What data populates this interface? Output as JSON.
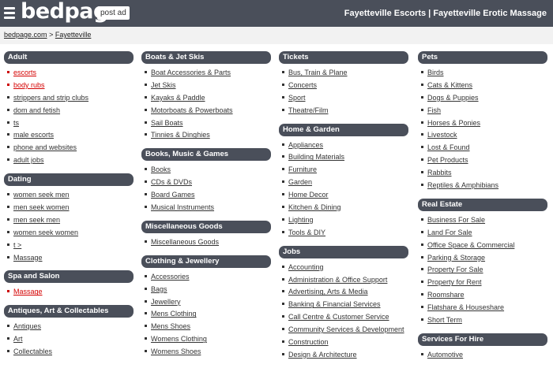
{
  "header": {
    "logo": "bedpage",
    "post_ad": "post ad",
    "title": "Fayetteville Escorts | Fayetteville Erotic Massage"
  },
  "breadcrumb": {
    "home": "bedpage.com",
    "sep": ">",
    "city": "Fayetteville"
  },
  "colors": {
    "header_bg": "#4a4f5a",
    "link_red": "#d40000"
  },
  "columns": [
    {
      "categories": [
        {
          "title": "Adult",
          "items": [
            {
              "label": "escorts",
              "red": true
            },
            {
              "label": "body rubs",
              "red": true
            },
            {
              "label": "strippers and strip clubs",
              "red": false
            },
            {
              "label": "dom and fetish",
              "red": false
            },
            {
              "label": "ts",
              "red": false
            },
            {
              "label": "male escorts",
              "red": false
            },
            {
              "label": "phone and websites",
              "red": false
            },
            {
              "label": "adult jobs",
              "red": false
            }
          ]
        },
        {
          "title": "Dating",
          "items": [
            {
              "label": "women seek men",
              "red": false
            },
            {
              "label": "men seek women",
              "red": false
            },
            {
              "label": "men seek men",
              "red": false
            },
            {
              "label": "women seek women",
              "red": false
            },
            {
              "label": "t >",
              "red": false
            },
            {
              "label": "Massage",
              "red": false
            }
          ]
        },
        {
          "title": "Spa and Salon",
          "items": [
            {
              "label": "Massage",
              "red": true
            }
          ]
        },
        {
          "title": "Antiques, Art & Collectables",
          "items": [
            {
              "label": "Antiques",
              "red": false
            },
            {
              "label": "Art",
              "red": false
            },
            {
              "label": "Collectables",
              "red": false
            }
          ]
        }
      ]
    },
    {
      "categories": [
        {
          "title": "Boats & Jet Skis",
          "items": [
            {
              "label": "Boat Accessories & Parts",
              "red": false
            },
            {
              "label": "Jet Skis",
              "red": false
            },
            {
              "label": "Kayaks & Paddle",
              "red": false
            },
            {
              "label": "Motorboats & Powerboats",
              "red": false
            },
            {
              "label": "Sail Boats",
              "red": false
            },
            {
              "label": "Tinnies & Dinghies",
              "red": false
            }
          ]
        },
        {
          "title": "Books, Music & Games",
          "items": [
            {
              "label": "Books",
              "red": false
            },
            {
              "label": "CDs & DVDs",
              "red": false
            },
            {
              "label": "Board Games",
              "red": false
            },
            {
              "label": "Musical Instruments",
              "red": false
            }
          ]
        },
        {
          "title": "Miscellaneous Goods",
          "items": [
            {
              "label": "Miscellaneous Goods",
              "red": false
            }
          ]
        },
        {
          "title": "Clothing & Jewellery",
          "items": [
            {
              "label": "Accessories",
              "red": false
            },
            {
              "label": "Bags",
              "red": false
            },
            {
              "label": "Jewellery",
              "red": false
            },
            {
              "label": "Mens Clothing",
              "red": false
            },
            {
              "label": "Mens Shoes",
              "red": false
            },
            {
              "label": "Womens Clothing",
              "red": false
            },
            {
              "label": "Womens Shoes",
              "red": false
            }
          ]
        }
      ]
    },
    {
      "categories": [
        {
          "title": "Tickets",
          "items": [
            {
              "label": "Bus, Train & Plane",
              "red": false
            },
            {
              "label": "Concerts",
              "red": false
            },
            {
              "label": "Sport",
              "red": false
            },
            {
              "label": "Theatre/Film",
              "red": false
            }
          ]
        },
        {
          "title": "Home & Garden",
          "items": [
            {
              "label": "Appliances",
              "red": false
            },
            {
              "label": "Building Materials",
              "red": false
            },
            {
              "label": "Furniture",
              "red": false
            },
            {
              "label": "Garden",
              "red": false
            },
            {
              "label": "Home Decor",
              "red": false
            },
            {
              "label": "Kitchen & Dining",
              "red": false
            },
            {
              "label": "Lighting",
              "red": false
            },
            {
              "label": "Tools & DIY",
              "red": false
            }
          ]
        },
        {
          "title": "Jobs",
          "items": [
            {
              "label": "Accounting",
              "red": false
            },
            {
              "label": "Administration & Office Support",
              "red": false
            },
            {
              "label": "Advertising, Arts & Media",
              "red": false
            },
            {
              "label": "Banking & Financial Services",
              "red": false
            },
            {
              "label": "Call Centre & Customer Service",
              "red": false
            },
            {
              "label": "Community Services & Development",
              "red": false
            },
            {
              "label": "Construction",
              "red": false
            },
            {
              "label": "Design & Architecture",
              "red": false
            }
          ]
        }
      ]
    },
    {
      "categories": [
        {
          "title": "Pets",
          "items": [
            {
              "label": "Birds",
              "red": false
            },
            {
              "label": "Cats & Kittens",
              "red": false
            },
            {
              "label": "Dogs & Puppies",
              "red": false
            },
            {
              "label": "Fish",
              "red": false
            },
            {
              "label": "Horses & Ponies",
              "red": false
            },
            {
              "label": "Livestock",
              "red": false
            },
            {
              "label": "Lost & Found",
              "red": false
            },
            {
              "label": "Pet Products",
              "red": false
            },
            {
              "label": "Rabbits",
              "red": false
            },
            {
              "label": "Reptiles & Amphibians",
              "red": false
            }
          ]
        },
        {
          "title": "Real Estate",
          "items": [
            {
              "label": "Business For Sale",
              "red": false
            },
            {
              "label": "Land For Sale",
              "red": false
            },
            {
              "label": "Office Space & Commercial",
              "red": false
            },
            {
              "label": "Parking & Storage",
              "red": false
            },
            {
              "label": "Property For Sale",
              "red": false
            },
            {
              "label": "Property for Rent",
              "red": false
            },
            {
              "label": "Roomshare",
              "red": false
            },
            {
              "label": "Flatshare & Houseshare",
              "red": false
            },
            {
              "label": "Short Term",
              "red": false
            }
          ]
        },
        {
          "title": "Services For Hire",
          "items": [
            {
              "label": "Automotive",
              "red": false
            }
          ]
        }
      ]
    }
  ]
}
